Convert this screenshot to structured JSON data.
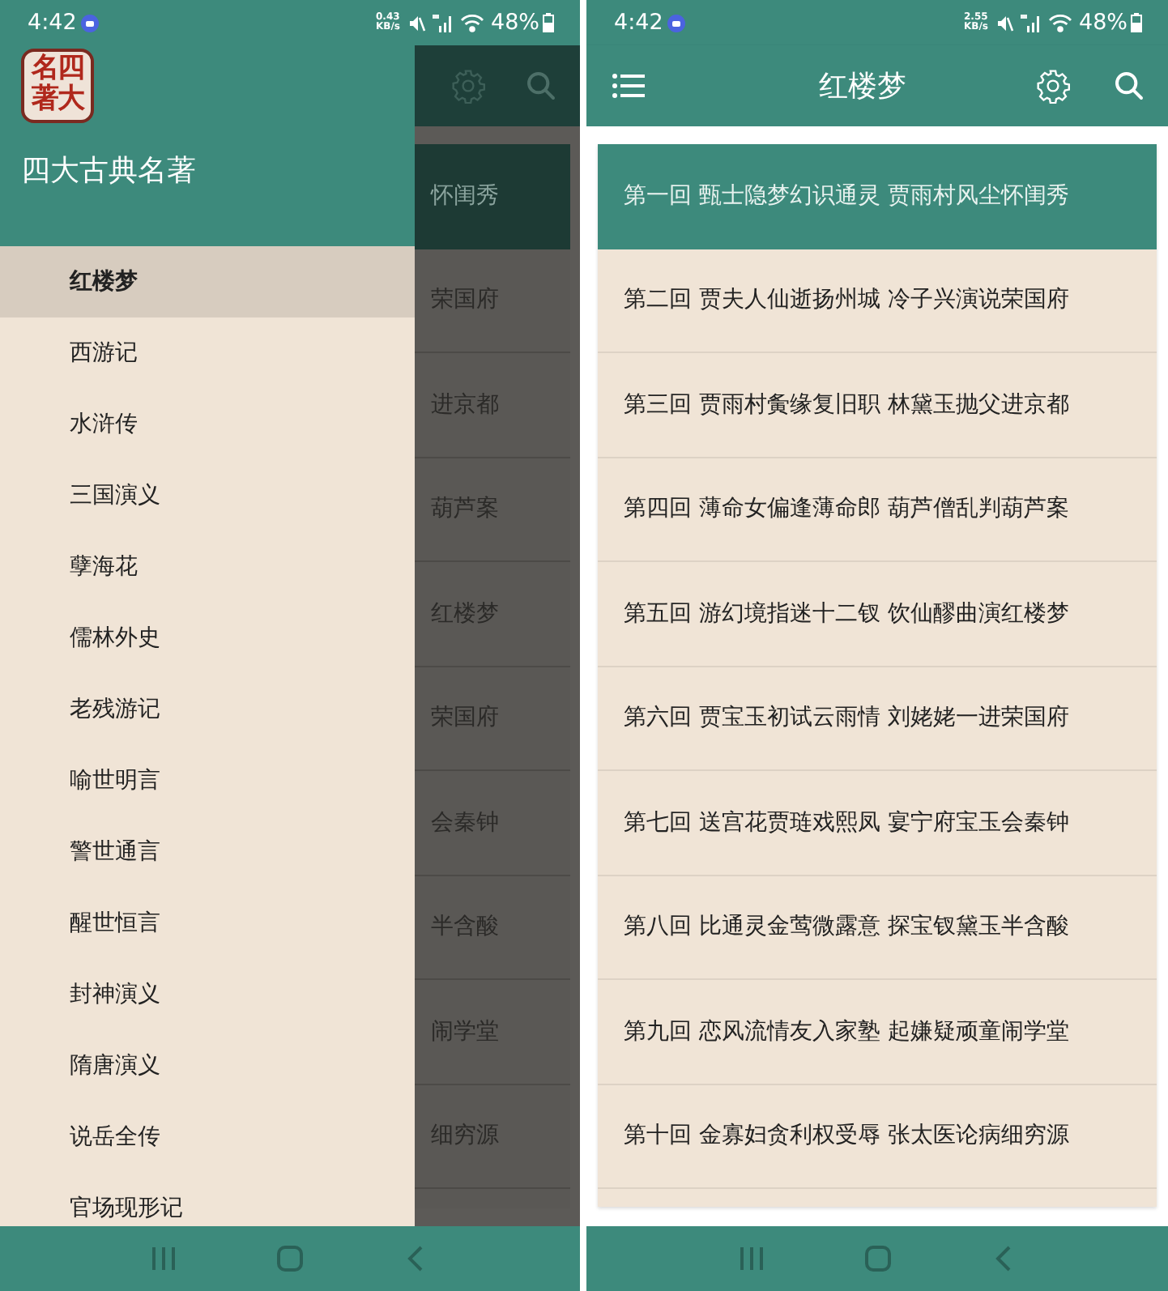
{
  "screens": [
    {
      "status_bar": {
        "time": "4:42",
        "speed": "0.43",
        "speed_unit": "KB/s",
        "battery": "48%"
      },
      "drawer": {
        "logo_lines": [
          "名四",
          "著大"
        ],
        "title": "四大古典名著",
        "items": [
          {
            "label": "红楼梦",
            "selected": true
          },
          {
            "label": "西游记",
            "selected": false
          },
          {
            "label": "水浒传",
            "selected": false
          },
          {
            "label": "三国演义",
            "selected": false
          },
          {
            "label": "孽海花",
            "selected": false
          },
          {
            "label": "儒林外史",
            "selected": false
          },
          {
            "label": "老残游记",
            "selected": false
          },
          {
            "label": "喻世明言",
            "selected": false
          },
          {
            "label": "警世通言",
            "selected": false
          },
          {
            "label": "醒世恒言",
            "selected": false
          },
          {
            "label": "封神演义",
            "selected": false
          },
          {
            "label": "隋唐演义",
            "selected": false
          },
          {
            "label": "说岳全传",
            "selected": false
          },
          {
            "label": "官场现形记",
            "selected": false
          }
        ]
      },
      "background_rows": [
        {
          "text": "怀闺秀",
          "selected": true
        },
        {
          "text": "荣国府",
          "selected": false
        },
        {
          "text": "进京都",
          "selected": false
        },
        {
          "text": "葫芦案",
          "selected": false
        },
        {
          "text": "红楼梦",
          "selected": false
        },
        {
          "text": "荣国府",
          "selected": false
        },
        {
          "text": "会秦钟",
          "selected": false
        },
        {
          "text": "半含酸",
          "selected": false
        },
        {
          "text": "闹学堂",
          "selected": false
        },
        {
          "text": "细穷源",
          "selected": false
        }
      ]
    },
    {
      "status_bar": {
        "time": "4:42",
        "speed": "2.55",
        "speed_unit": "KB/s",
        "battery": "48%"
      },
      "toolbar": {
        "title": "红楼梦"
      },
      "chapters": [
        {
          "text": "第一回 甄士隐梦幻识通灵 贾雨村风尘怀闺秀",
          "selected": true
        },
        {
          "text": "第二回 贾夫人仙逝扬州城 冷子兴演说荣国府",
          "selected": false
        },
        {
          "text": "第三回 贾雨村夤缘复旧职 林黛玉抛父进京都",
          "selected": false
        },
        {
          "text": "第四回 薄命女偏逢薄命郎 葫芦僧乱判葫芦案",
          "selected": false
        },
        {
          "text": "第五回 游幻境指迷十二钗 饮仙醪曲演红楼梦",
          "selected": false
        },
        {
          "text": "第六回 贾宝玉初试云雨情 刘姥姥一进荣国府",
          "selected": false
        },
        {
          "text": "第七回 送宫花贾琏戏熙凤 宴宁府宝玉会秦钟",
          "selected": false
        },
        {
          "text": "第八回 比通灵金莺微露意 探宝钗黛玉半含酸",
          "selected": false
        },
        {
          "text": "第九回 恋风流情友入家塾 起嫌疑顽童闹学堂",
          "selected": false
        },
        {
          "text": "第十回 金寡妇贪利权受辱 张太医论病细穷源",
          "selected": false
        }
      ]
    }
  ]
}
